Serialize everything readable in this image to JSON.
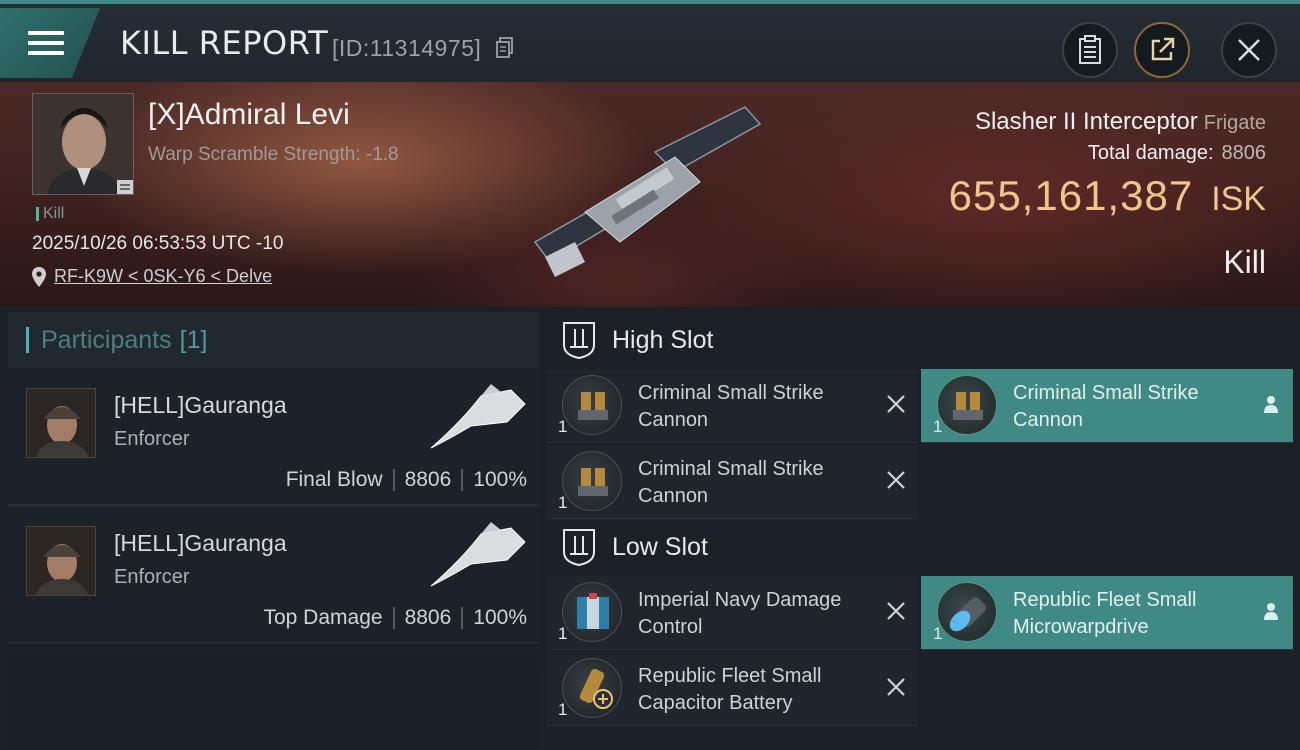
{
  "header": {
    "menu_icon": "hamburger-menu-icon",
    "title": "KILL REPORT",
    "report_id": "[ID:11314975]",
    "buttons": [
      "clipboard-icon",
      "share-icon",
      "close-icon"
    ]
  },
  "victim": {
    "name": "[X]Admiral Levi",
    "warp_scramble": "Warp Scramble Strength: -1.8",
    "tag": "Kill",
    "timestamp": "2025/10/26 06:53:53 UTC -10",
    "location": "RF-K9W < 0SK-Y6 < Delve",
    "ship_name": "Slasher II Interceptor",
    "ship_class": "Frigate",
    "total_damage_label": "Total damage:",
    "total_damage": "8806",
    "isk_value": "655,161,387",
    "isk_unit": "ISK",
    "result": "Kill"
  },
  "participants": {
    "title": "Participants",
    "count": "[1]",
    "rows": [
      {
        "name": "[HELL]Gauranga",
        "role": "Enforcer",
        "stat_label": "Final Blow",
        "damage": "8806",
        "percent": "100%"
      },
      {
        "name": "[HELL]Gauranga",
        "role": "Enforcer",
        "stat_label": "Top Damage",
        "damage": "8806",
        "percent": "100%"
      }
    ]
  },
  "fitting": {
    "high_slot": {
      "label": "High Slot",
      "modules": [
        {
          "name": "Criminal Small Strike Cannon",
          "qty": "1",
          "state": "destroyed",
          "icon": "cannon-icon"
        },
        {
          "name": "Criminal Small Strike Cannon",
          "qty": "1",
          "state": "dropped",
          "icon": "cannon-icon"
        },
        {
          "name": "Criminal Small Strike Cannon",
          "qty": "1",
          "state": "destroyed",
          "icon": "cannon-icon"
        }
      ]
    },
    "low_slot": {
      "label": "Low Slot",
      "modules": [
        {
          "name": "Imperial Navy Damage Control",
          "qty": "1",
          "state": "destroyed",
          "icon": "damage-control-icon"
        },
        {
          "name": "Republic Fleet Small Microwarpdrive",
          "qty": "1",
          "state": "dropped",
          "icon": "microwarpdrive-icon"
        },
        {
          "name": "Republic Fleet Small Capacitor Battery",
          "qty": "1",
          "state": "destroyed",
          "icon": "capacitor-battery-icon"
        }
      ]
    },
    "colors": {
      "dropped_bg": "#3f8a85",
      "isk": "#f0c68a",
      "accent": "#4fb0b6"
    }
  }
}
